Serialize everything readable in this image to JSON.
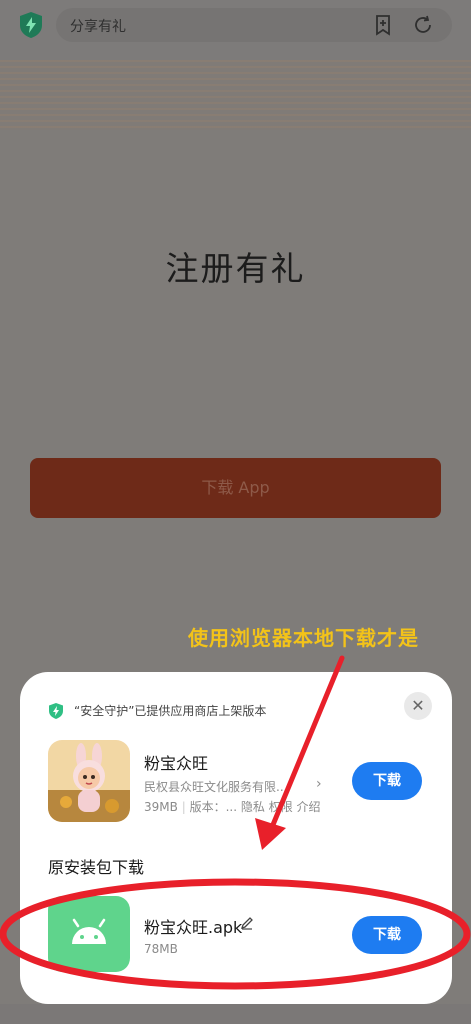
{
  "browser": {
    "title": "分享有礼",
    "shield_icon": "shield-bolt-icon",
    "bookmark_icon": "bookmark-add-icon",
    "refresh_icon": "refresh-icon"
  },
  "page": {
    "headline": "注册有礼",
    "download_button": "下载 App"
  },
  "annotation": {
    "text": "使用浏览器本地下载才是",
    "color": "#f3c319"
  },
  "sheet": {
    "secure_text": "“安全守护”已提供应用商店上架版本",
    "close_icon": "close-icon",
    "store_app": {
      "name": "粉宝众旺",
      "developer": "民权县众旺文化服务有限...",
      "size": "39MB",
      "version": "版本：...",
      "privacy": "隐私",
      "permission": "权限",
      "intro": "介绍",
      "download_label": "下载"
    },
    "section_title": "原安装包下载",
    "apk": {
      "name": "粉宝众旺.apk",
      "size": "78MB",
      "icon": "android-icon",
      "download_label": "下载"
    }
  },
  "colors": {
    "primary_button": "#1e7cf1",
    "apk_icon_bg": "#5fd48c",
    "annotation_red": "#e8202a"
  }
}
